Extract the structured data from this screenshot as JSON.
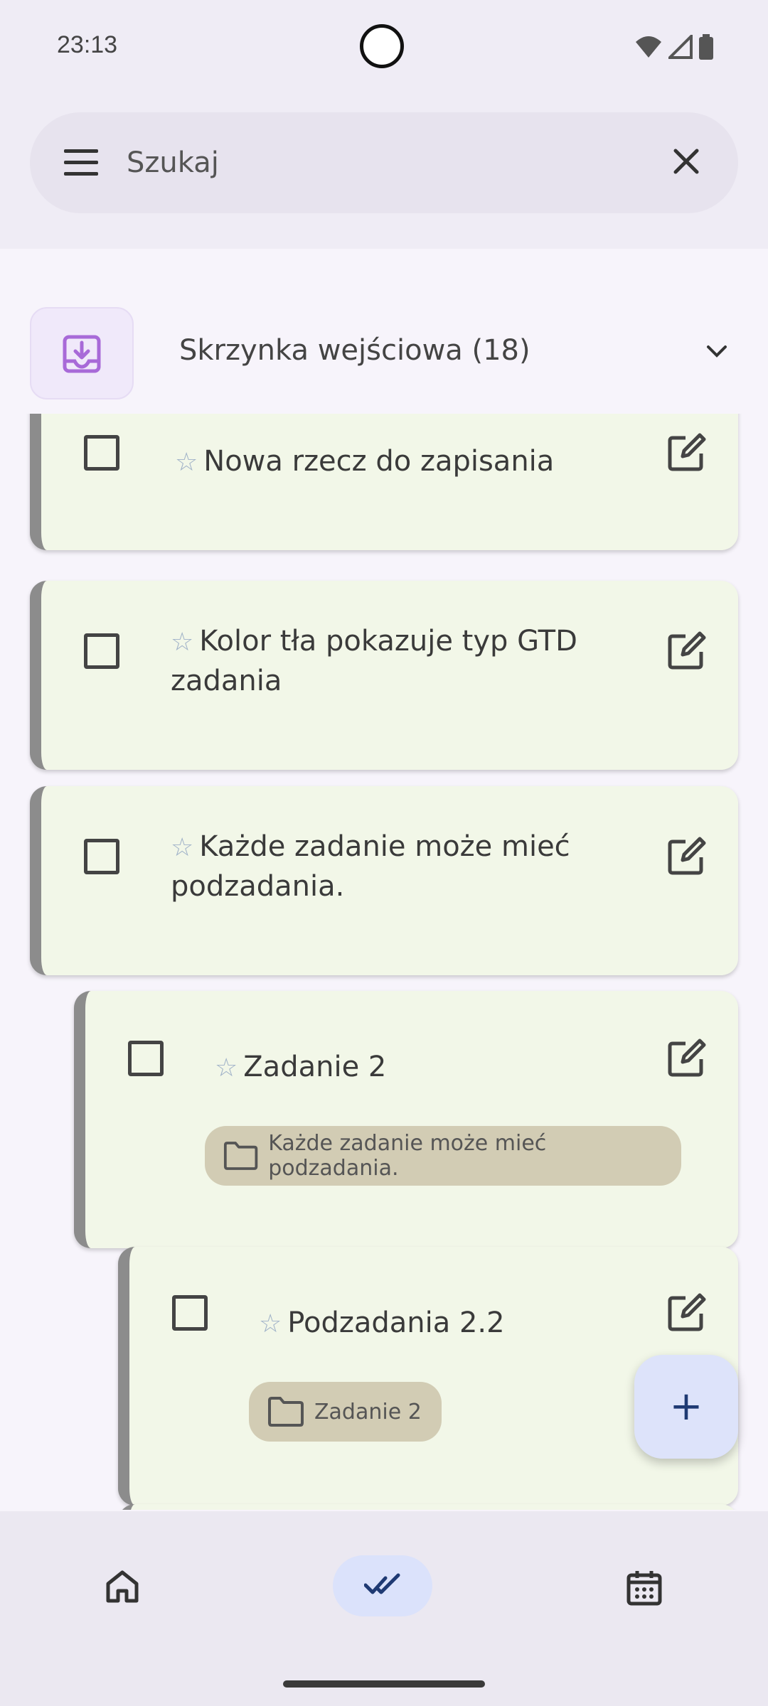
{
  "status_bar": {
    "time": "23:13"
  },
  "search": {
    "placeholder": "Szukaj"
  },
  "inbox": {
    "title": "Skrzynka wejściowa (18)"
  },
  "tasks": [
    {
      "title": "Nowa rzecz do zapisania",
      "level": 0
    },
    {
      "title": "Kolor tła pokazuje typ GTD zadania",
      "level": 0
    },
    {
      "title": "Każde zadanie może mieć podzadania.",
      "level": 0
    },
    {
      "title": "Zadanie 2",
      "level": 1,
      "parent": "Każde zadanie może mieć podzadania."
    },
    {
      "title": "Podzadania 2.2",
      "level": 2,
      "parent": "Zadanie 2"
    }
  ],
  "fab": {
    "label": "+"
  },
  "nav": [
    {
      "name": "home",
      "active": false
    },
    {
      "name": "tasks",
      "active": true
    },
    {
      "name": "calendar",
      "active": false
    }
  ],
  "colors": {
    "card_background": "#f2f7e8",
    "card_stripe": "#8c8c8c",
    "chip_background": "#d2ccb4",
    "accent": "#dbe2fb",
    "star": "#9fb1c8"
  }
}
